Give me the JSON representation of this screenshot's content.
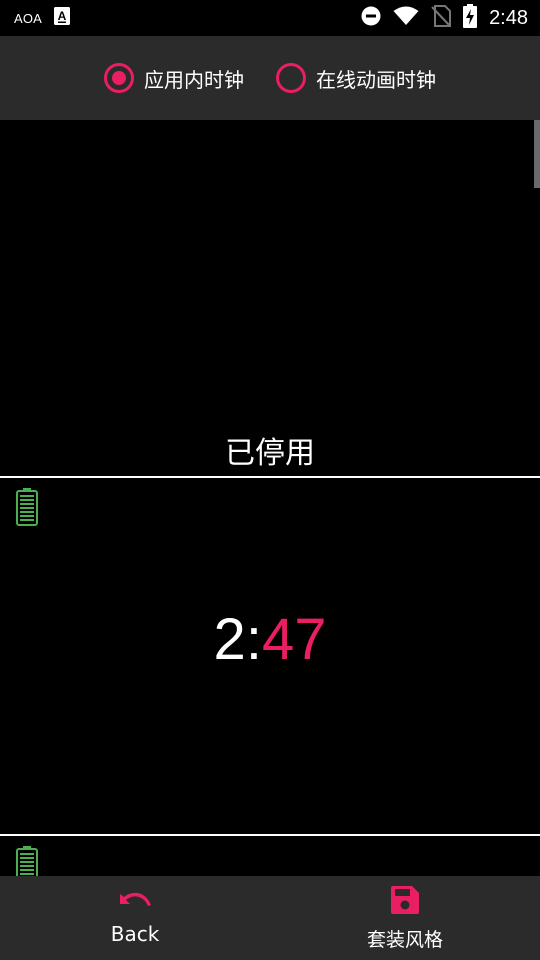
{
  "status_bar": {
    "carrier": "AOA",
    "time": "2:48",
    "icons": [
      "accessibility-a-icon",
      "do-not-disturb-icon",
      "wifi-icon",
      "no-sim-icon",
      "battery-charging-icon"
    ]
  },
  "mode_selector": {
    "options": [
      {
        "label": "应用内时钟",
        "selected": true
      },
      {
        "label": "在线动画时钟",
        "selected": false
      }
    ]
  },
  "previews": {
    "disabled_label": "已停用",
    "clock_hour": "2",
    "clock_sep": ":",
    "clock_min": "47"
  },
  "bottom_bar": {
    "back_label": "Back",
    "style_label": "套装风格"
  },
  "colors": {
    "accent": "#e91e63",
    "battery": "#4caf50",
    "bar_bg": "#2b2b2b"
  }
}
